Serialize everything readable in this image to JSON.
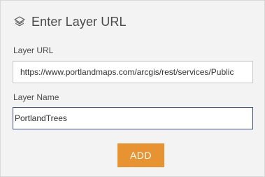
{
  "header": {
    "icon": "layers-icon",
    "title": "Enter Layer URL"
  },
  "form": {
    "layer_url": {
      "label": "Layer URL",
      "value": "https://www.portlandmaps.com/arcgis/rest/services/Public"
    },
    "layer_name": {
      "label": "Layer Name",
      "value": "PortlandTrees"
    }
  },
  "actions": {
    "add_label": "ADD"
  },
  "colors": {
    "accent": "#e89331",
    "focus_border": "#3a4f8a"
  }
}
